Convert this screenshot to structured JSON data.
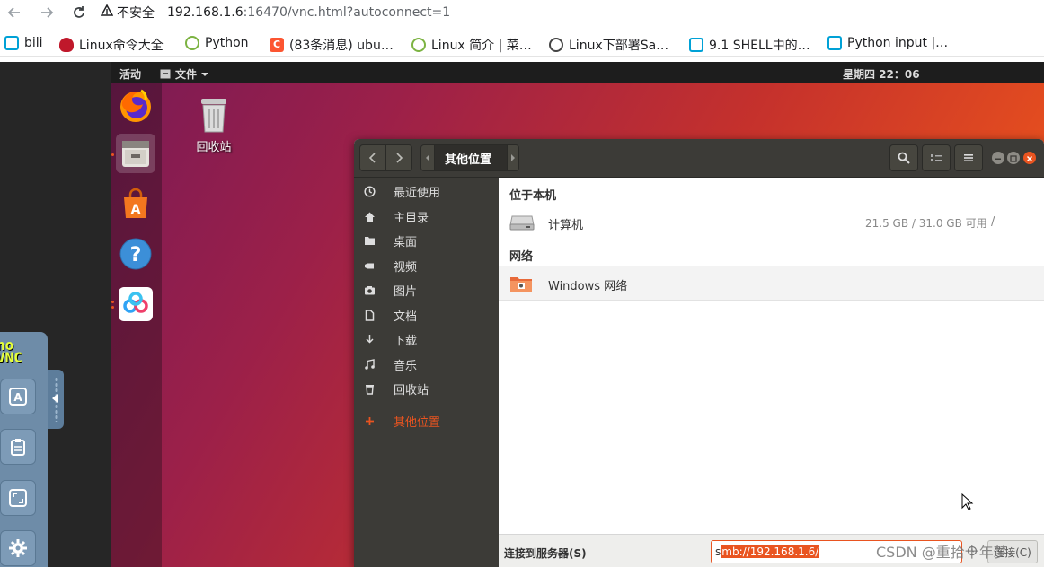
{
  "browser": {
    "security_label": "不安全",
    "url_host": "192.168.1.6",
    "url_rest": ":16470/vnc.html?autoconnect=1",
    "bookmarks": [
      {
        "label": "bili",
        "color": "#00a1d6"
      },
      {
        "label": "Linux命令大全",
        "color": "#c0182b"
      },
      {
        "label": "Python",
        "color": "#7cb342"
      },
      {
        "label": "(83条消息) ubu…",
        "color": "#fc5531"
      },
      {
        "label": "Linux 简介 | 菜…",
        "color": "#7cb342"
      },
      {
        "label": "Linux下部署Sa…",
        "color": "#444444"
      },
      {
        "label": "9.1 SHELL中的…",
        "color": "#00a1d6"
      },
      {
        "label": "Python input |…",
        "color": "#00a1d6"
      }
    ]
  },
  "novnc": {
    "logo_top": "no",
    "logo_bottom": "VNC"
  },
  "ubuntu": {
    "activities": "活动",
    "files_menu": "文件",
    "clock": "星期四 22：06",
    "trash_label": "回收站"
  },
  "nautilus": {
    "path_label": "其他位置",
    "sidebar": [
      {
        "label": "最近使用",
        "icon": "clock-icon"
      },
      {
        "label": "主目录",
        "icon": "home-icon"
      },
      {
        "label": "桌面",
        "icon": "folder-icon"
      },
      {
        "label": "视频",
        "icon": "video-icon"
      },
      {
        "label": "图片",
        "icon": "camera-icon"
      },
      {
        "label": "文档",
        "icon": "document-icon"
      },
      {
        "label": "下载",
        "icon": "download-icon"
      },
      {
        "label": "音乐",
        "icon": "music-icon"
      },
      {
        "label": "回收站",
        "icon": "trash-icon"
      },
      {
        "label": "其他位置",
        "icon": "plus-icon"
      }
    ],
    "section_local": "位于本机",
    "computer_label": "计算机",
    "computer_size": "21.5 GB / 31.0 GB 可用",
    "computer_path": "/",
    "section_network": "网络",
    "windows_network": "Windows 网络",
    "connect_label": "连接到服务器(S)",
    "server_prefix": "s",
    "server_selected": "mb://192.168.1.6/",
    "connect_button": "连接(C)"
  },
  "watermark": "CSDN @重拾十年梦",
  "colors": {
    "accent": "#e95420",
    "sidebar_bg": "#3c3b37"
  }
}
